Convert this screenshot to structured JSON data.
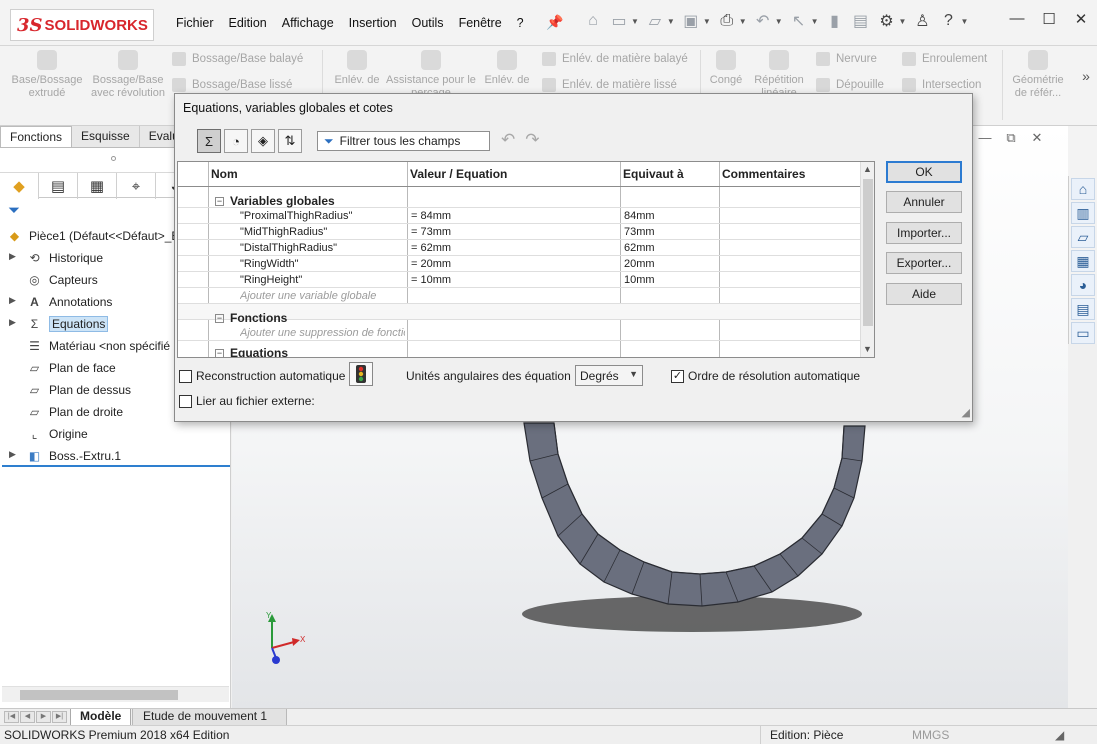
{
  "app": {
    "brand_prefix": "3S",
    "brand_main": "SOLID",
    "brand_suffix": "WORKS",
    "menu": [
      "Fichier",
      "Edition",
      "Affichage",
      "Insertion",
      "Outils",
      "Fenêtre",
      "?"
    ]
  },
  "ribbon": {
    "base_bossage": "Base/Bossage extrudé",
    "bossage_revolution": "Bossage/Base avec révolution",
    "bossage_balaye": "Bossage/Base balayé",
    "bossage_lisse": "Bossage/Base lissé",
    "enlev_de_1": "Enlév. de",
    "assistance": "Assistance pour le perçage",
    "enlev_de_2": "Enlév. de",
    "enlev_balaye": "Enlév. de matière balayé",
    "enlev_lisse": "Enlév. de matière lissé",
    "conge": "Congé",
    "repetition": "Répétition linéaire",
    "nervure": "Nervure",
    "depouille": "Dépouille",
    "enroulement": "Enroulement",
    "intersection": "Intersection",
    "geometrie": "Géométrie de référ...",
    "more": "»"
  },
  "cmd_tabs": [
    "Fonctions",
    "Esquisse",
    "Evalue"
  ],
  "tree": {
    "root": "Pièce1  (Défaut<<Défaut>_E",
    "items": [
      "Historique",
      "Capteurs",
      "Annotations",
      "Equations",
      "Matériau <non spécifié",
      "Plan de face",
      "Plan de dessus",
      "Plan de droite",
      "Origine",
      "Boss.-Extru.1"
    ]
  },
  "dialog": {
    "title": "Equations, variables globales et cotes",
    "filter_placeholder": "Filtrer tous les champs",
    "columns": [
      "Nom",
      "Valeur / Equation",
      "Equivaut à",
      "Commentaires"
    ],
    "section_globals": "Variables globales",
    "rows": [
      {
        "name": "\"ProximalThighRadius\"",
        "value": "= 84mm",
        "equiv": "84mm"
      },
      {
        "name": "\"MidThighRadius\"",
        "value": "= 73mm",
        "equiv": "73mm"
      },
      {
        "name": "\"DistalThighRadius\"",
        "value": "= 62mm",
        "equiv": "62mm"
      },
      {
        "name": "\"RingWidth\"",
        "value": "= 20mm",
        "equiv": "20mm"
      },
      {
        "name": "\"RingHeight\"",
        "value": "= 10mm",
        "equiv": "10mm"
      }
    ],
    "add_global": "Ajouter une variable globale",
    "section_functions": "Fonctions",
    "add_function": "Ajouter une suppression de fonction",
    "section_equations": "Equations",
    "buttons": {
      "ok": "OK",
      "cancel": "Annuler",
      "import": "Importer...",
      "export": "Exporter...",
      "help": "Aide"
    },
    "auto_rebuild": "Reconstruction automatique",
    "link_external": "Lier au fichier externe:",
    "angle_units_label": "Unités angulaires des équation",
    "angle_units_value": "Degrés",
    "auto_solve": "Ordre de résolution automatique",
    "auto_rebuild_checked": false,
    "link_external_checked": false,
    "auto_solve_checked": true
  },
  "bottom_tabs": {
    "model": "Modèle",
    "motion": "Etude de mouvement 1"
  },
  "status": {
    "edition_left": "SOLIDWORKS Premium 2018 x64 Edition",
    "edition_mode": "Edition: Pièce",
    "units": "MMGS"
  },
  "triad": {
    "x": "X",
    "y": "Y"
  },
  "colors": {
    "accent": "#2c7bd1",
    "brand": "#d8262c",
    "ring": "#6c7180"
  }
}
